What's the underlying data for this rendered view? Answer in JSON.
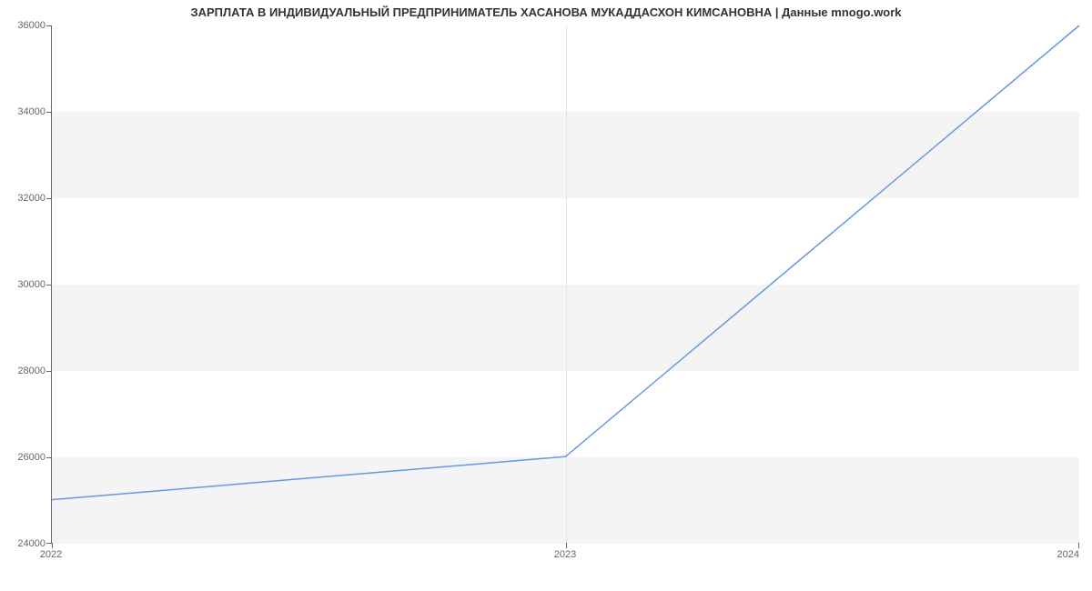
{
  "chart_data": {
    "type": "line",
    "title": "ЗАРПЛАТА В ИНДИВИДУАЛЬНЫЙ ПРЕДПРИНИМАТЕЛЬ ХАСАНОВА МУКАДДАСХОН КИМСАНОВНА | Данные mnogo.work",
    "x": [
      "2022",
      "2023",
      "2024"
    ],
    "values": [
      25000,
      26000,
      36000
    ],
    "xlabel": "",
    "ylabel": "",
    "ylim": [
      24000,
      36000
    ],
    "y_ticks": [
      24000,
      26000,
      28000,
      30000,
      32000,
      34000,
      36000
    ],
    "line_color": "#6699dd"
  }
}
